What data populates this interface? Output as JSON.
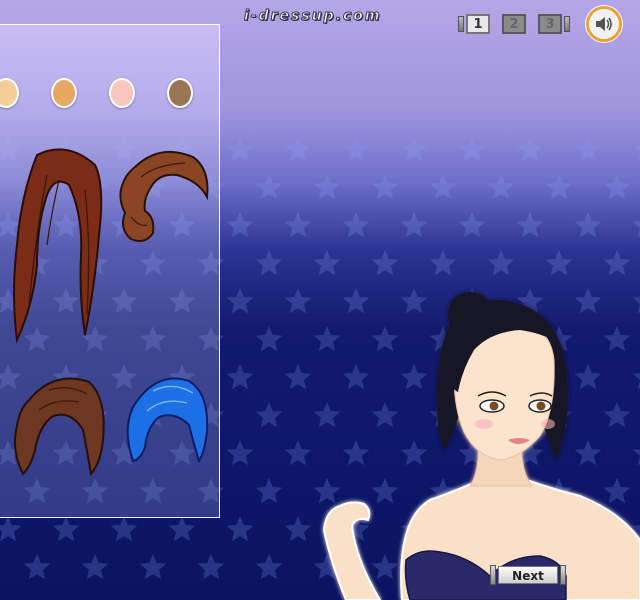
{
  "site": {
    "logo_text": "i-dressup.com"
  },
  "pager": {
    "pages": [
      {
        "label": "1",
        "active": true
      },
      {
        "label": "2",
        "active": false
      },
      {
        "label": "3",
        "active": false
      }
    ]
  },
  "sound": {
    "icon": "speaker-icon"
  },
  "panel": {
    "skin_tones": [
      "#f1cf97",
      "#e8a862",
      "#f7c6bd",
      "#987653"
    ],
    "hair_styles": [
      {
        "name": "long-auburn-hair",
        "color": "#7a2c16"
      },
      {
        "name": "side-bun-brown-hair",
        "color": "#8a4524"
      },
      {
        "name": "short-brown-bob-hair",
        "color": "#6d3721"
      },
      {
        "name": "short-blue-hair",
        "color": "#1d6fe6"
      }
    ]
  },
  "model": {
    "hair_color": "#141426",
    "top_color": "#2c2c6a"
  },
  "actions": {
    "next_label": "Next"
  },
  "colors": {
    "panel_border": "#ffffff",
    "sound_ring": "#e8a13a"
  }
}
